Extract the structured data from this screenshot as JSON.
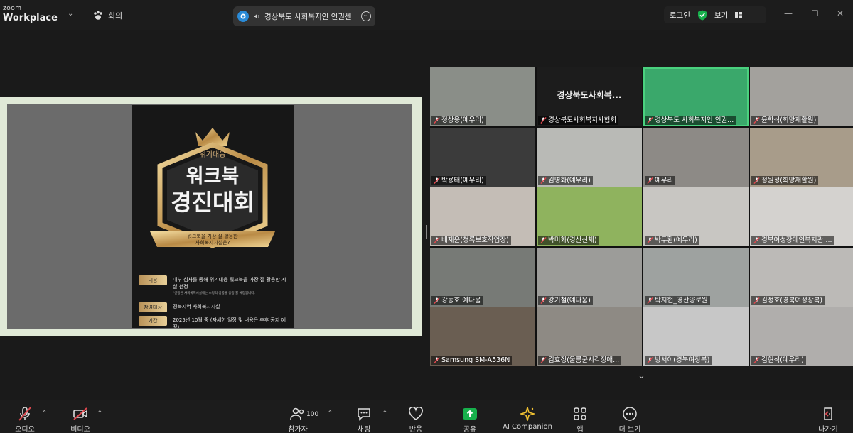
{
  "app": {
    "brand_small": "zoom",
    "brand_large": "Workplace",
    "meeting_tab": "회의",
    "meeting_title": "경상북도 사회복지인 인권센",
    "login": "로그인",
    "view": "보기"
  },
  "share": {
    "poster": {
      "subtitle": "위기대응",
      "title_line1": "워크북",
      "title_line2": "경진대회",
      "ribbon_line1": "워크북을 가장 잘 활용한",
      "ribbon_line2": "사회복지시설은?",
      "rows": [
        {
          "label": "내용",
          "value": "내부 심사를 통해 위기대응 워크북을 가장 잘 활용한 시설 선정"
        },
        {
          "label": "참여대상",
          "value": "경북지역 사회복지시설"
        },
        {
          "label": "기간",
          "value": "2025년 10월 중 (자세한 일정 및 내용은 추후 공지 예정)"
        }
      ],
      "note": "*선정된 사회복지시설에는 소정의 상품을 증정 할 예정입니다."
    }
  },
  "gallery": {
    "tiles": [
      {
        "name": "정상용(예우리)",
        "bg": "#8a8e88",
        "center": ""
      },
      {
        "name": "경상북도사회복지사협회",
        "bg": "#1c1c1c",
        "center": "경상북도사회복..."
      },
      {
        "name": "경상북도 사회복지인 인권...",
        "bg": "#3aa86b",
        "center": "",
        "active": true
      },
      {
        "name": "윤학식(희망재활원)",
        "bg": "#a3a19d",
        "center": ""
      },
      {
        "name": "박용태(예우리)",
        "bg": "#3b3b3b",
        "center": ""
      },
      {
        "name": "김명화(예우리)",
        "bg": "#b9bab6",
        "center": ""
      },
      {
        "name": "예우리",
        "bg": "#8d8a86",
        "center": ""
      },
      {
        "name": "정원정(희망재활원)",
        "bg": "#a89c8a",
        "center": ""
      },
      {
        "name": "배재윤(청록보호작업장)",
        "bg": "#c4bdb6",
        "center": ""
      },
      {
        "name": "박미화(경산신체)",
        "bg": "#8fb35e",
        "center": ""
      },
      {
        "name": "박두환(예우리)",
        "bg": "#c8c6c2",
        "center": ""
      },
      {
        "name": "경북여성장애인복지관 ...",
        "bg": "#d4d2cf",
        "center": ""
      },
      {
        "name": "강동호 예다움",
        "bg": "#777a76",
        "center": ""
      },
      {
        "name": "강기철(예다움)",
        "bg": "#9c9c99",
        "center": ""
      },
      {
        "name": "박지현_경산양로원",
        "bg": "#9ea2a0",
        "center": ""
      },
      {
        "name": "김정호(경북여성장복)",
        "bg": "#bcbab7",
        "center": ""
      },
      {
        "name": "Samsung SM-A536N",
        "bg": "#6a5e52",
        "center": ""
      },
      {
        "name": "김효정(울릉군시각장애...",
        "bg": "#8e8a84",
        "center": ""
      },
      {
        "name": "방서이(경북여장복)",
        "bg": "#c7c7c7",
        "center": ""
      },
      {
        "name": "김현석(예우리)",
        "bg": "#b0aeac",
        "center": ""
      }
    ]
  },
  "toolbar": {
    "audio": "오디오",
    "video": "비디오",
    "participants": "참가자",
    "participants_count": "100",
    "chat": "채팅",
    "react": "반응",
    "share": "공유",
    "ai": "AI Companion",
    "apps": "앱",
    "more": "더 보기",
    "leave": "나가기"
  },
  "colors": {
    "accent_green": "#4ad17e",
    "share_green": "#17b04c",
    "mute_red": "#e0484f",
    "ai_yellow": "#f1c232"
  }
}
